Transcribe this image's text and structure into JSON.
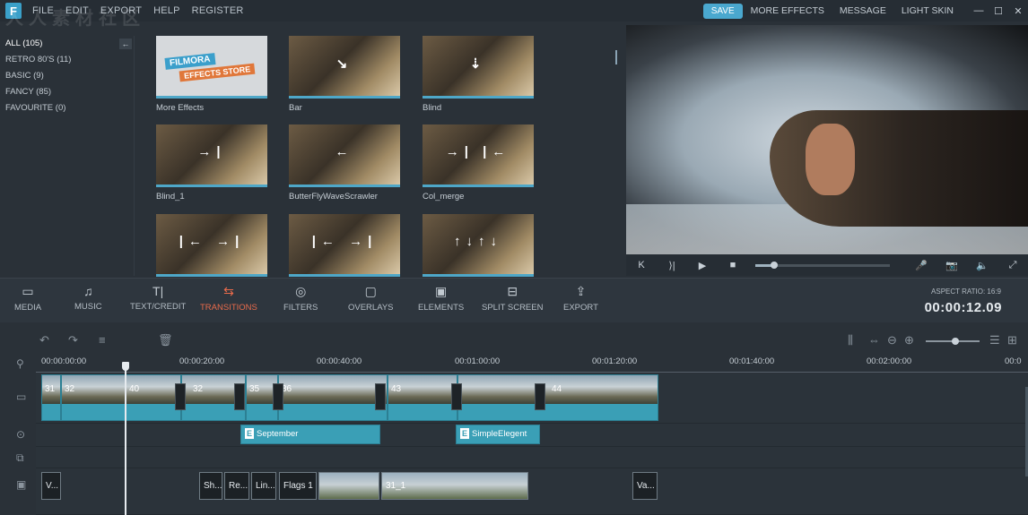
{
  "app": {
    "logo_letter": "F"
  },
  "menu": [
    "FILE",
    "EDIT",
    "EXPORT",
    "HELP",
    "REGISTER"
  ],
  "topbar": {
    "save_label": "SAVE",
    "links": [
      "MORE EFFECTS",
      "MESSAGE",
      "LIGHT SKIN"
    ],
    "window_controls": [
      "—",
      "☐",
      "✕"
    ]
  },
  "categories": [
    {
      "label": "ALL (105)",
      "active": true
    },
    {
      "label": "RETRO 80'S (11)",
      "active": false
    },
    {
      "label": "BASIC (9)",
      "active": false
    },
    {
      "label": "FANCY (85)",
      "active": false
    },
    {
      "label": "FAVOURITE (0)",
      "active": false
    }
  ],
  "collapse_icon": "←",
  "store_tile": {
    "line1": "FILMORA",
    "line2": "EFFECTS STORE"
  },
  "effects": [
    {
      "label": "More Effects",
      "glyph": "",
      "store": true
    },
    {
      "label": "Bar",
      "glyph": "↘",
      "store": false
    },
    {
      "label": "Blind",
      "glyph": "⇣",
      "store": false
    },
    {
      "label": "Blind_1",
      "glyph": "→|",
      "store": false
    },
    {
      "label": "ButterFlyWaveScrawler",
      "glyph": "←",
      "store": false
    },
    {
      "label": "Col_merge",
      "glyph": "→| |←",
      "store": false
    },
    {
      "label": "",
      "glyph": "|← →|",
      "store": false
    },
    {
      "label": "",
      "glyph": "|← →|",
      "store": false
    },
    {
      "label": "",
      "glyph": "↑↓↑↓",
      "store": false
    }
  ],
  "player": {
    "buttons": [
      "K",
      "⟩|",
      "▶",
      "■"
    ],
    "progress": 0.14,
    "right_icons": [
      "mic-icon",
      "camera-icon",
      "volume-icon",
      "fullscreen-icon"
    ],
    "right_glyphs": [
      "🎤",
      "📷",
      "🔈",
      "⤢"
    ]
  },
  "tools": [
    {
      "label": "MEDIA",
      "icon": "▭",
      "active": false
    },
    {
      "label": "MUSIC",
      "icon": "♫",
      "active": false
    },
    {
      "label": "TEXT/CREDIT",
      "icon": "T|",
      "active": false
    },
    {
      "label": "TRANSITIONS",
      "icon": "⇆",
      "active": true
    },
    {
      "label": "FILTERS",
      "icon": "◎",
      "active": false
    },
    {
      "label": "OVERLAYS",
      "icon": "▢",
      "active": false
    },
    {
      "label": "ELEMENTS",
      "icon": "▣",
      "active": false
    },
    {
      "label": "SPLIT SCREEN",
      "icon": "⊟",
      "active": false
    },
    {
      "label": "EXPORT",
      "icon": "⇪",
      "active": false
    }
  ],
  "aspect_ratio": "ASPECT RATIO: 16:9",
  "timecode": "00:00:12.09",
  "timeline_tools": [
    "↶",
    "↷",
    "≡",
    "🗑"
  ],
  "timeline_right_tools": [
    "⫼",
    "⇔",
    "⊖",
    "⊕",
    "☰",
    "⊞"
  ],
  "zoom_level": 0.55,
  "ruler": [
    "00:00:00:00",
    "00:00:20:00",
    "00:00:40:00",
    "00:01:00:00",
    "00:01:20:00",
    "00:01:40:00",
    "00:02:00:00",
    "00:0"
  ],
  "video_clips": [
    "31",
    "32",
    "40",
    "32",
    "35",
    "36",
    "43",
    "44"
  ],
  "text_clips": [
    {
      "badge": "E",
      "label": "September"
    },
    {
      "badge": "E",
      "label": "SimpleElegent"
    }
  ],
  "media_clips": [
    "V...",
    "Sh...",
    "Re...",
    "Lin...",
    "Flags 1",
    "",
    "31_1",
    "Va..."
  ],
  "watermark": "人人素材社区"
}
